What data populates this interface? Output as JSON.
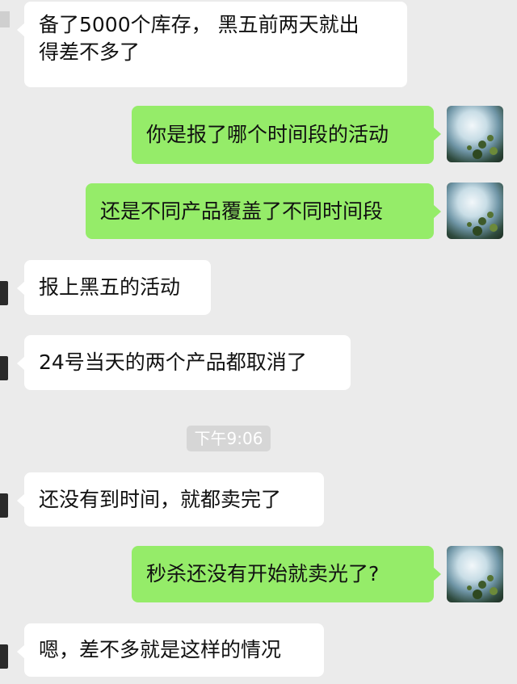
{
  "messages": [
    {
      "side": "in",
      "text": "备了5000个库存， 黑五前两天就出\n得差不多了"
    },
    {
      "side": "out",
      "text": "你是报了哪个时间段的活动"
    },
    {
      "side": "out",
      "text": "还是不同产品覆盖了不同时间段"
    },
    {
      "side": "in",
      "text": "报上黑五的活动"
    },
    {
      "side": "in",
      "text": "24号当天的两个产品都取消了"
    },
    {
      "side": "in",
      "text": "还没有到时间，就都卖完了"
    },
    {
      "side": "out",
      "text": "秒杀还没有开始就卖光了?"
    },
    {
      "side": "in",
      "text": "嗯，差不多就是这样的情况"
    }
  ],
  "timestamp": "下午9:06",
  "colors": {
    "background": "#ebebeb",
    "incoming_bubble": "#ffffff",
    "outgoing_bubble": "#95ec69",
    "timestamp_badge": "#d6d6d6"
  },
  "icons": {
    "contact_avatar": "contact-avatar-icon",
    "self_avatar": "self-avatar-icon"
  }
}
